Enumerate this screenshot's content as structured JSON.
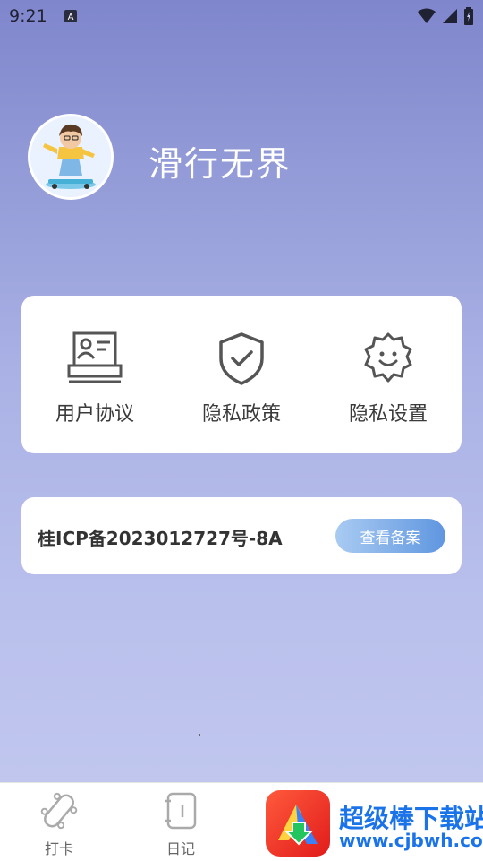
{
  "status_bar": {
    "time": "9:21"
  },
  "header": {
    "app_title": "滑行无界"
  },
  "links": [
    {
      "label": "用户协议",
      "icon": "user-card-icon"
    },
    {
      "label": "隐私政策",
      "icon": "shield-check-icon"
    },
    {
      "label": "隐私设置",
      "icon": "gear-smile-icon"
    }
  ],
  "icp": {
    "text": "桂ICP备2023012727号-8A",
    "button_label": "查看备案"
  },
  "bottom_nav": [
    {
      "label": "打卡",
      "icon": "skateboard-icon"
    },
    {
      "label": "日记",
      "icon": "notebook-icon"
    }
  ],
  "watermark": {
    "title": "超级棒下载站",
    "url": "www.cjbwh.com"
  },
  "colors": {
    "accent": "#5f96e0",
    "watermark": "#1a73e8"
  }
}
